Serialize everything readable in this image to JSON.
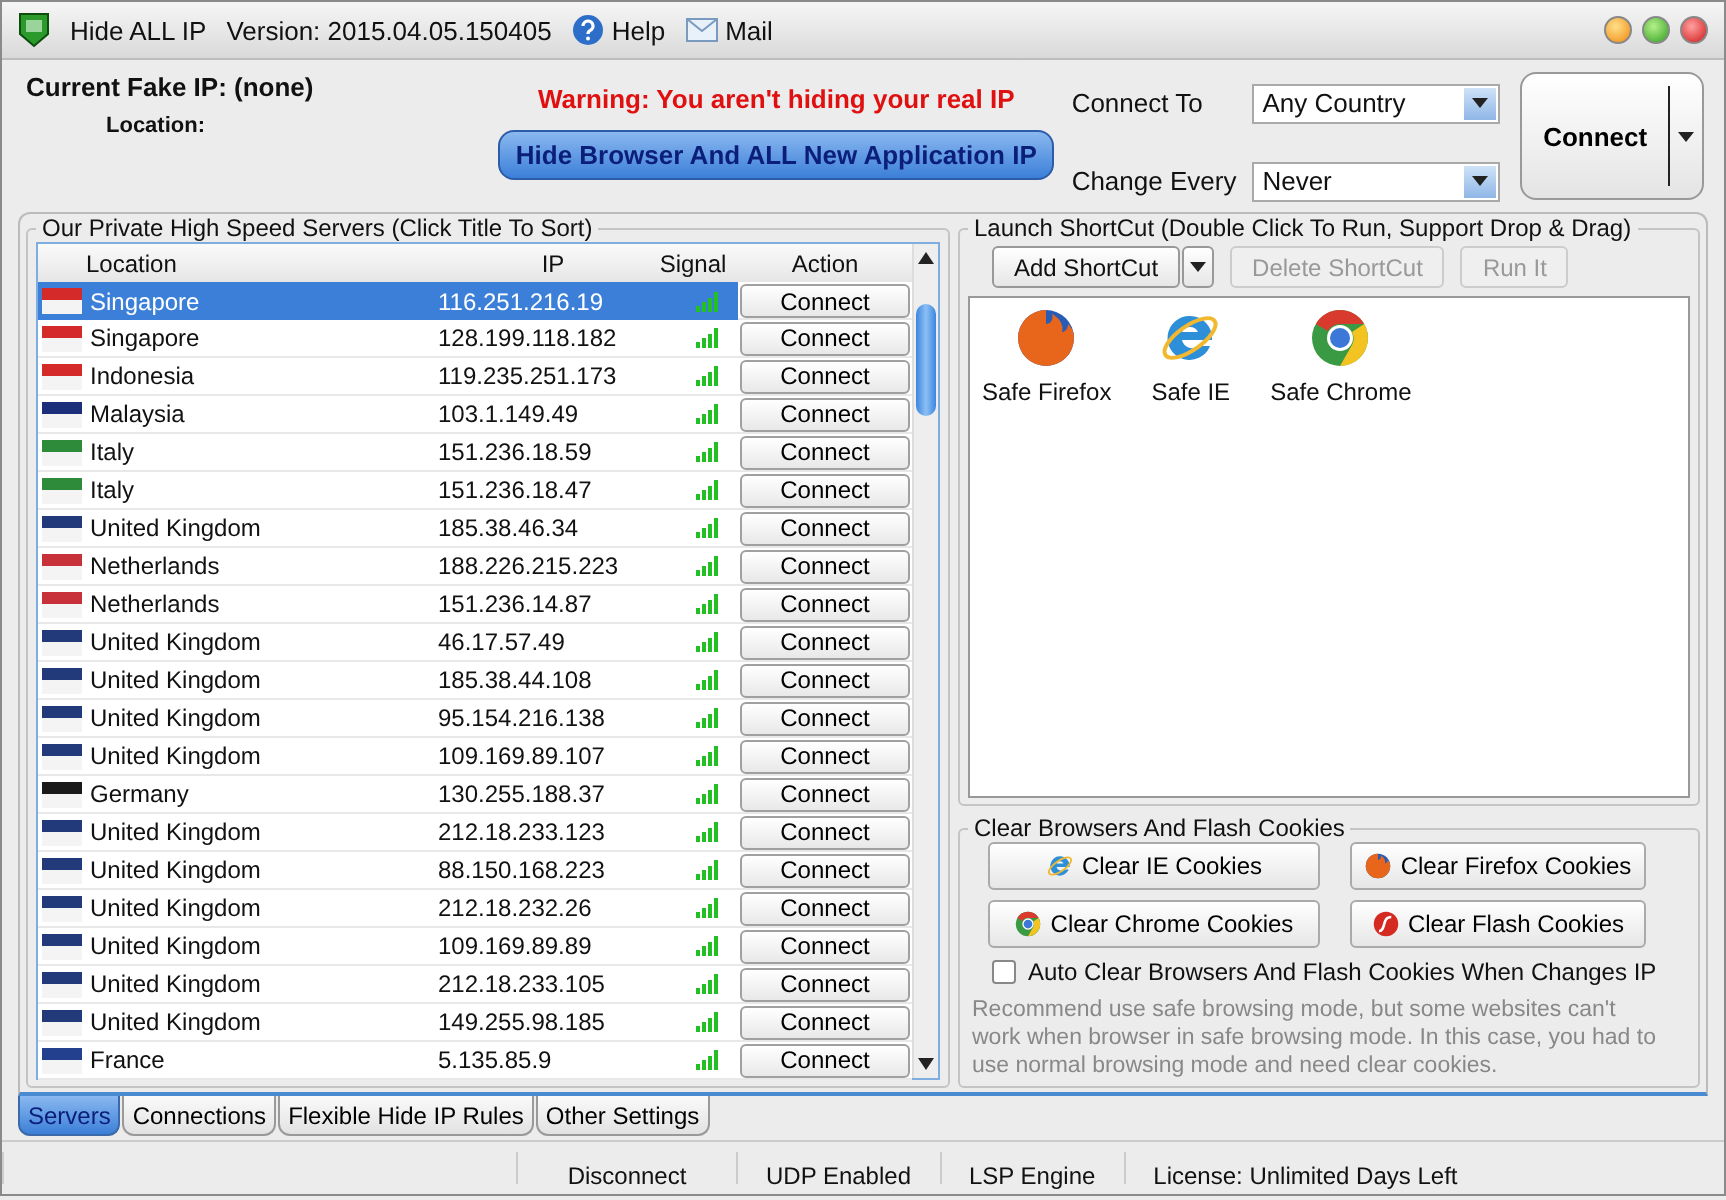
{
  "window": {
    "title": "Hide ALL IP",
    "version": "Version: 2015.04.05.150405",
    "help": "Help",
    "mail": "Mail"
  },
  "top": {
    "current_ip": "Current Fake IP: (none)",
    "location": "Location:",
    "warning": "Warning: You aren't hiding your real IP",
    "hide_button": "Hide Browser And ALL New Application IP",
    "connect_to_label": "Connect To",
    "connect_to_value": "Any Country",
    "change_every_label": "Change Every",
    "change_every_value": "Never",
    "connect_button": "Connect"
  },
  "servers": {
    "title": "Our Private High Speed Servers (Click Title To Sort)",
    "columns": [
      "Location",
      "IP",
      "Signal",
      "Action"
    ],
    "rows": [
      {
        "location": "Singapore",
        "ip": "116.251.216.19",
        "action": "Connect",
        "selected": true,
        "color": "#d42a2a"
      },
      {
        "location": "Singapore",
        "ip": "128.199.118.182",
        "action": "Connect",
        "selected": false,
        "color": "#d42a2a"
      },
      {
        "location": "Indonesia",
        "ip": "119.235.251.173",
        "action": "Connect",
        "selected": false,
        "color": "#d42a2a"
      },
      {
        "location": "Malaysia",
        "ip": "103.1.149.49",
        "action": "Connect",
        "selected": false,
        "color": "#1c2d7a"
      },
      {
        "location": "Italy",
        "ip": "151.236.18.59",
        "action": "Connect",
        "selected": false,
        "color": "#2e8b3a"
      },
      {
        "location": "Italy",
        "ip": "151.236.18.47",
        "action": "Connect",
        "selected": false,
        "color": "#2e8b3a"
      },
      {
        "location": "United Kingdom",
        "ip": "185.38.46.34",
        "action": "Connect",
        "selected": false,
        "color": "#233a7a"
      },
      {
        "location": "Netherlands",
        "ip": "188.226.215.223",
        "action": "Connect",
        "selected": false,
        "color": "#c8303a"
      },
      {
        "location": "Netherlands",
        "ip": "151.236.14.87",
        "action": "Connect",
        "selected": false,
        "color": "#c8303a"
      },
      {
        "location": "United Kingdom",
        "ip": "46.17.57.49",
        "action": "Connect",
        "selected": false,
        "color": "#233a7a"
      },
      {
        "location": "United Kingdom",
        "ip": "185.38.44.108",
        "action": "Connect",
        "selected": false,
        "color": "#233a7a"
      },
      {
        "location": "United Kingdom",
        "ip": "95.154.216.138",
        "action": "Connect",
        "selected": false,
        "color": "#233a7a"
      },
      {
        "location": "United Kingdom",
        "ip": "109.169.89.107",
        "action": "Connect",
        "selected": false,
        "color": "#233a7a"
      },
      {
        "location": "Germany",
        "ip": "130.255.188.37",
        "action": "Connect",
        "selected": false,
        "color": "#1a1a1a"
      },
      {
        "location": "United Kingdom",
        "ip": "212.18.233.123",
        "action": "Connect",
        "selected": false,
        "color": "#233a7a"
      },
      {
        "location": "United Kingdom",
        "ip": "88.150.168.223",
        "action": "Connect",
        "selected": false,
        "color": "#233a7a"
      },
      {
        "location": "United Kingdom",
        "ip": "212.18.232.26",
        "action": "Connect",
        "selected": false,
        "color": "#233a7a"
      },
      {
        "location": "United Kingdom",
        "ip": "109.169.89.89",
        "action": "Connect",
        "selected": false,
        "color": "#233a7a"
      },
      {
        "location": "United Kingdom",
        "ip": "212.18.233.105",
        "action": "Connect",
        "selected": false,
        "color": "#233a7a"
      },
      {
        "location": "United Kingdom",
        "ip": "149.255.98.185",
        "action": "Connect",
        "selected": false,
        "color": "#233a7a"
      },
      {
        "location": "France",
        "ip": "5.135.85.9",
        "action": "Connect",
        "selected": false,
        "color": "#23408e"
      }
    ]
  },
  "shortcuts": {
    "title": "Launch ShortCut (Double Click To Run, Support Drop & Drag)",
    "buttons": [
      {
        "label": "Add ShortCut",
        "disabled": false
      },
      {
        "label": "Delete ShortCut",
        "disabled": true
      },
      {
        "label": "Run It",
        "disabled": true
      }
    ],
    "items": [
      {
        "label": "Safe Firefox",
        "kind": "firefox"
      },
      {
        "label": "Safe IE",
        "kind": "ie"
      },
      {
        "label": "Safe Chrome",
        "kind": "chrome"
      }
    ]
  },
  "cookies": {
    "title": "Clear Browsers And Flash Cookies",
    "buttons": [
      {
        "label": "Clear IE Cookies",
        "kind": "ie"
      },
      {
        "label": "Clear Firefox Cookies",
        "kind": "firefox"
      },
      {
        "label": "Clear Chrome Cookies",
        "kind": "chrome"
      },
      {
        "label": "Clear Flash Cookies",
        "kind": "flash"
      }
    ],
    "auto_clear": {
      "label": "Auto Clear Browsers And Flash Cookies When Changes IP",
      "checked": false
    },
    "note": "Recommend use safe browsing mode, but some websites can't work when browser in safe browsing mode. In this case, you had to use normal browsing mode and need clear cookies."
  },
  "tabs": [
    {
      "label": "Servers",
      "selected": true
    },
    {
      "label": "Connections",
      "selected": false
    },
    {
      "label": "Flexible Hide IP Rules",
      "selected": false
    },
    {
      "label": "Other Settings",
      "selected": false
    }
  ],
  "status_bar": [
    "Disconnect",
    "UDP Enabled",
    "LSP Engine",
    "License: Unlimited Days Left"
  ]
}
